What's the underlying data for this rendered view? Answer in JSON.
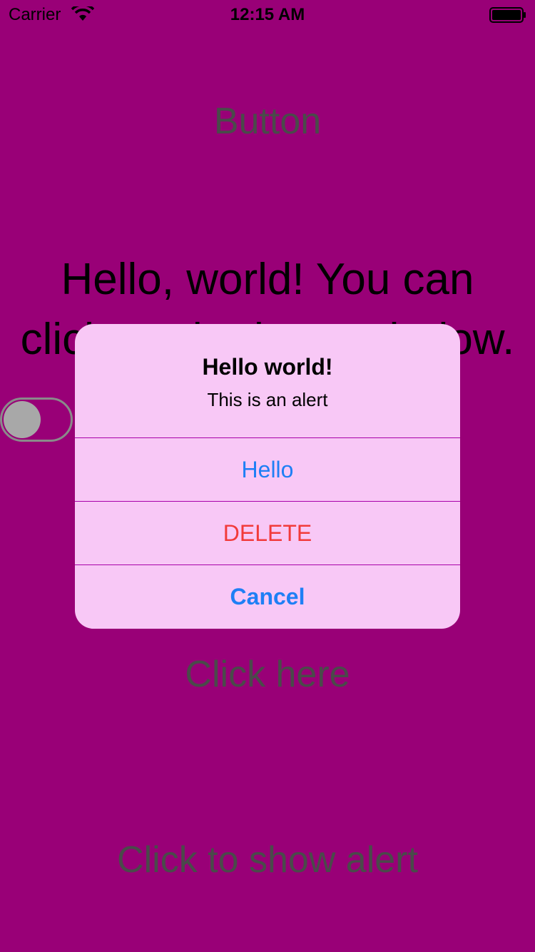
{
  "status_bar": {
    "carrier": "Carrier",
    "time": "12:15 AM",
    "icons": [
      "wifi-icon",
      "battery-icon"
    ]
  },
  "screen": {
    "background_color": "#990077",
    "top_button_label": "Button",
    "hello_text_line1": "Hello, world! You can",
    "hello_text_line2": "click on the button below.",
    "switch_on": false,
    "click_here_label": "Click here",
    "show_alert_label": "Click to show alert"
  },
  "alert": {
    "title": "Hello world!",
    "message": "This is an alert",
    "actions": [
      {
        "label": "Hello",
        "style": "default",
        "color": "#1f7ff5"
      },
      {
        "label": "DELETE",
        "style": "destructive",
        "color": "#f23a3a"
      },
      {
        "label": "Cancel",
        "style": "cancel",
        "color": "#1f7ff5"
      }
    ],
    "background_color": "#f8c8f6"
  }
}
